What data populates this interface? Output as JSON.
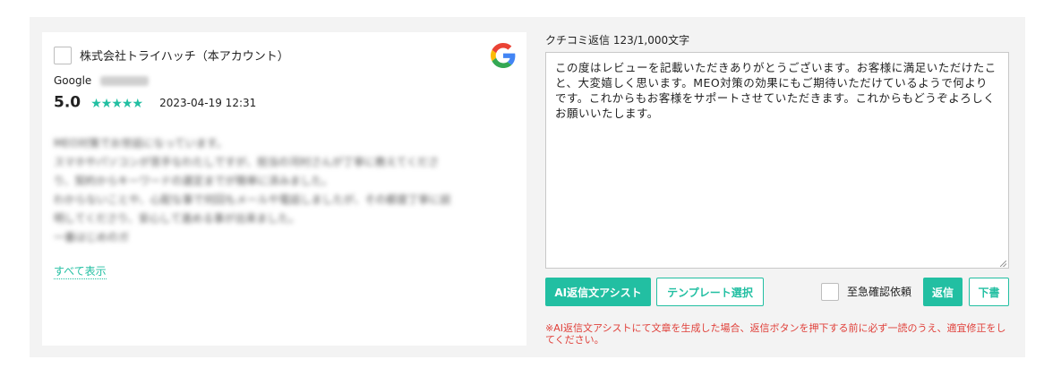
{
  "review": {
    "account_name": "株式会社トライハッチ（本アカウント）",
    "source": "Google",
    "rating": "5.0",
    "stars": 5,
    "date": "2023-04-19 12:31",
    "blurred_lines": [
      "MEO対策でお世話になっています。",
      "スマホやパソコンが苦手なわたしですが、担当の河村さんが丁寧に教えてくださ",
      "り、契約からキーワードの選定までが簡単に済みました。",
      "わからないことや、心配な事で何回もメールや電話しましたが、その都度丁寧に説",
      "明してくださり、安心して進める事が出来ました。",
      "一番はじめのガ"
    ],
    "show_all_label": "すべて表示"
  },
  "reply": {
    "label": "クチコミ返信 123/1,000文字",
    "text": "この度はレビューを記載いただきありがとうございます。お客様に満足いただけたこと、大変嬉しく思います。MEO対策の効果にもご期待いただけているようで何よりです。これからもお客様をサポートさせていただきます。これからもどうぞよろしくお願いいたします。"
  },
  "actions": {
    "ai_assist": "AI返信文アシスト",
    "template": "テンプレート選択",
    "urgent_label": "至急確認依頼",
    "reply": "返信",
    "draft": "下書"
  },
  "notice": "※AI返信文アシストにて文章を生成した場合、返信ボタンを押下する前に必ず一読のうえ、適宜修正をしてください。",
  "colors": {
    "accent": "#22bfa2",
    "warning": "#e0403a",
    "panel_bg": "#f3f3f3"
  }
}
